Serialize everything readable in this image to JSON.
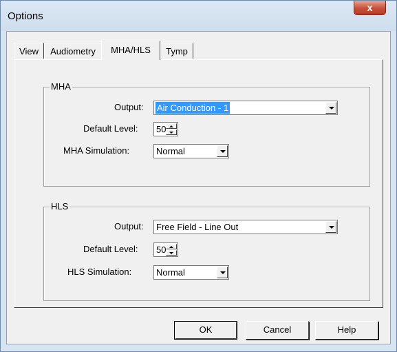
{
  "window": {
    "title": "Options",
    "close_label": "x"
  },
  "tabs": [
    {
      "label": "View"
    },
    {
      "label": "Audiometry"
    },
    {
      "label": "MHA/HLS"
    },
    {
      "label": "Tymp"
    }
  ],
  "mha": {
    "group_label": "MHA",
    "output_label": "Output:",
    "output_value": "Air Conduction - 1",
    "level_label": "Default Level:",
    "level_value": "50",
    "sim_label": "MHA Simulation:",
    "sim_value": "Normal"
  },
  "hls": {
    "group_label": "HLS",
    "output_label": "Output:",
    "output_value": "Free Field - Line Out",
    "level_label": "Default Level:",
    "level_value": "50",
    "sim_label": "HLS Simulation:",
    "sim_value": "Normal"
  },
  "buttons": {
    "ok": "OK",
    "cancel": "Cancel",
    "help": "Help"
  }
}
